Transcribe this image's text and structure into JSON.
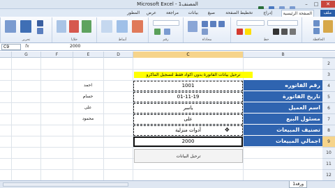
{
  "window": {
    "title": "Microsoft Excel - المصنف1",
    "minimize": "–",
    "maximize": "□",
    "close": "✕"
  },
  "tabs": [
    "ملف",
    "الصفحة الرئيسية",
    "إدراج",
    "تخطيط الصفحة",
    "صيغ",
    "بيانات",
    "مراجعة",
    "عرض",
    "المطور"
  ],
  "active_tab_index": 1,
  "ribbon_groups": [
    "الحافظة",
    "خط",
    "محاذاة",
    "رقم",
    "أنماط",
    "خلايا",
    "تحرير"
  ],
  "formula_bar": {
    "name_box": "C9",
    "fx": "fx",
    "value": "2000"
  },
  "columns": [
    "B",
    "C",
    "D",
    "E",
    "F",
    "G"
  ],
  "selected_column": "C",
  "rows": [
    "2",
    "3",
    "4",
    "5",
    "6",
    "7",
    "8",
    "9",
    "10",
    "11",
    "12"
  ],
  "selected_row": "9",
  "banner": "ترحيل بيانات الفاتورة بدون اكواد فقط لتسجيل الماكرو",
  "form": [
    {
      "label": "رقم الفاتوره",
      "value": "1001",
      "side": "احمد"
    },
    {
      "label": "تاريخ الفاتورة",
      "value": "01-11-19",
      "side": "حسام"
    },
    {
      "label": "اسم العميل",
      "value": "ياسر",
      "side": "على"
    },
    {
      "label": "مسئول البيع",
      "value": "على",
      "side": "محمود"
    },
    {
      "label": "تصنيف المبيعات",
      "value": "أدوات منزلية",
      "side": ""
    },
    {
      "label": "اجمالي المبيعات",
      "value": "2000",
      "side": ""
    }
  ],
  "post_button": "ترحيل البيانات",
  "sheets": [
    "ورقة1"
  ],
  "colors": {
    "label_bg": "#2f64b0",
    "banner_bg": "#ffff00",
    "selection": "#f6d48b"
  }
}
